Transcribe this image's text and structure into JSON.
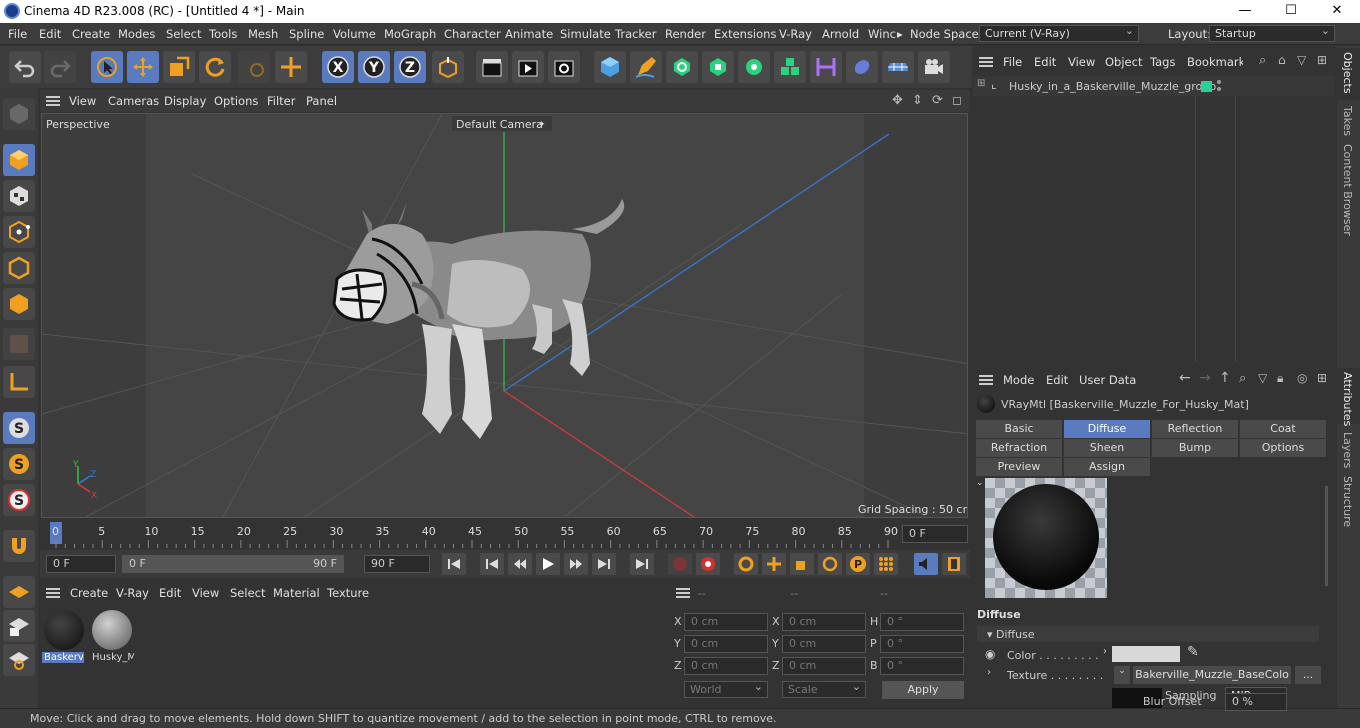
{
  "window": {
    "title": "Cinema 4D R23.008 (RC) - [Untitled 4 *] - Main",
    "min": "—",
    "max": "☐",
    "close": "✕"
  },
  "menubar": {
    "items": [
      "File",
      "Edit",
      "Create",
      "Modes",
      "Select",
      "Tools",
      "Mesh",
      "Spline",
      "Volume",
      "MoGraph",
      "Character",
      "Animate",
      "Simulate",
      "Tracker",
      "Render",
      "Extensions",
      "V-Ray",
      "Arnold",
      "Winc"
    ],
    "more": "▸",
    "node_space_label": "Node Space:",
    "node_space_value": "Current (V-Ray)",
    "layout_label": "Layout:",
    "layout_value": "Startup"
  },
  "toolbar": {
    "axis_x": "X",
    "axis_y": "Y",
    "axis_z": "Z"
  },
  "viewport": {
    "menu": [
      "View",
      "Cameras",
      "Display",
      "Options",
      "Filter",
      "Panel"
    ],
    "label": "Perspective",
    "camera": "Default Camera",
    "camera_icon": "✦",
    "grid": "Grid Spacing : 50 cm",
    "axis_y": "Y",
    "axis_z": "Z",
    "axis_x": "X"
  },
  "timeline": {
    "ticks": [
      "0",
      "5",
      "10",
      "15",
      "20",
      "25",
      "30",
      "35",
      "40",
      "45",
      "50",
      "55",
      "60",
      "65",
      "70",
      "75",
      "80",
      "85",
      "90"
    ],
    "current_frame": "0 F"
  },
  "transport": {
    "start": "0 F",
    "range_start": "0 F",
    "range_end": "90 F",
    "end": "90 F"
  },
  "material_manager": {
    "menu": [
      "Create",
      "V-Ray",
      "Edit",
      "View",
      "Select",
      "Material",
      "Texture"
    ],
    "materials": [
      {
        "name": "Baskervi"
      },
      {
        "name": "Husky_M"
      }
    ]
  },
  "coordinates": {
    "headers": [
      "--",
      "--",
      "--"
    ],
    "rows": [
      {
        "a": "X",
        "av": "0 cm",
        "b": "X",
        "bv": "0 cm",
        "c": "H",
        "cv": "0 °"
      },
      {
        "a": "Y",
        "av": "0 cm",
        "b": "Y",
        "bv": "0 cm",
        "c": "P",
        "cv": "0 °"
      },
      {
        "a": "Z",
        "av": "0 cm",
        "b": "Z",
        "bv": "0 cm",
        "c": "B",
        "cv": "0 °"
      }
    ],
    "world": "World",
    "scale": "Scale",
    "apply": "Apply"
  },
  "objects": {
    "menu": [
      "File",
      "Edit",
      "View",
      "Object",
      "Tags",
      "Bookmarks"
    ],
    "item": "Husky_in_a_Baskerville_Muzzle_group"
  },
  "attributes": {
    "menu": [
      "Mode",
      "Edit",
      "User Data"
    ],
    "material": "VRayMtl [Baskerville_Muzzle_For_Husky_Mat]",
    "tabs_row1": [
      "Basic",
      "Diffuse",
      "Reflection",
      "Coat"
    ],
    "tabs_row2": [
      "Refraction",
      "Sheen",
      "Bump",
      "Options"
    ],
    "tabs_row3": [
      "Preview Settings",
      "Assign"
    ],
    "section": "Diffuse",
    "subsection": "▾ Diffuse",
    "color_label": "Color . . . . . . . . .",
    "texture_label": "Texture . . . . . . . .",
    "texture_value": "Bakerville_Muzzle_BaseColo",
    "more": "...",
    "sampling_label": "Sampling",
    "sampling_value": "MIP",
    "blur_label": "Blur Offset",
    "blur_value": "0 %"
  },
  "side_tabs": [
    "Objects",
    "Takes",
    "Content Browser",
    "Attributes",
    "Layers",
    "Structure"
  ],
  "status": "Move: Click and drag to move elements. Hold down SHIFT to quantize movement / add to the selection in point mode, CTRL to remove.",
  "colors": {
    "accent": "#5a7bbf",
    "green_tag": "#22d39a"
  }
}
